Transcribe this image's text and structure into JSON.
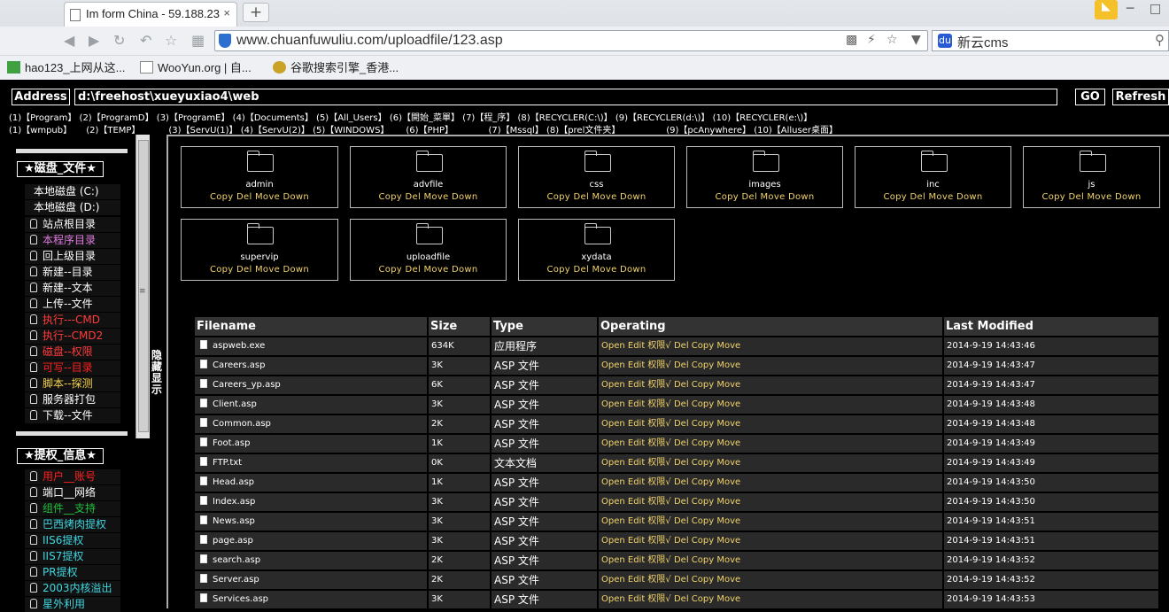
{
  "browser": {
    "tab_title": "Im form China - 59.188.23",
    "tab_close": "×",
    "new_tab": "+",
    "url": "www.chuanfuwuliu.com/uploadfile/123.asp",
    "search_text": "新云cms",
    "search_engine": "du",
    "bookmarks": [
      "hao123_上网从这...",
      "WooYun.org | 自...",
      "谷歌搜索引擎_香港..."
    ]
  },
  "shell": {
    "address_label": "Address",
    "address_value": "d:\\freehost\\xueyuxiao4\\web",
    "go_label": "GO",
    "refresh_label": "Refresh",
    "quick_row1": [
      "(1)【Program】",
      "(2)【ProgramD】",
      "(3)【ProgramE】",
      "(4)【Documents】",
      "(5)【All_Users】",
      "(6)【開始_菜單】",
      "(7)【程_序】",
      "(8)【RECYCLER(C:\\)】",
      "(9)【RECYCLER(d:\\)】",
      "(10)【RECYCLER(e:\\)】"
    ],
    "quick_row2": [
      "(1)【wmpub】",
      "(2)【TEMP】",
      "(3)【ServU(1)】",
      "(4)【ServU(2)】",
      "(5)【WINDOWS】",
      "(6)【PHP】",
      "(7)【Mssql】",
      "(8)【prel文件夹】",
      "(9)【pcAnywhere】",
      "(10)【Alluser桌面】"
    ],
    "hide_show": "隐藏 显示"
  },
  "sidebar": {
    "group1_title": "★磁盘_文件★",
    "disks": [
      "本地磁盘 (C:)",
      "本地磁盘 (D:)"
    ],
    "group1_items": [
      {
        "label": "站点根目录",
        "color": "#ffffff"
      },
      {
        "label": "本程序目录",
        "color": "#e07be0"
      },
      {
        "label": "回上级目录",
        "color": "#ffffff"
      },
      {
        "label": "新建--目录",
        "color": "#ffffff"
      },
      {
        "label": "新建--文本",
        "color": "#ffffff"
      },
      {
        "label": "上传--文件",
        "color": "#ffffff"
      },
      {
        "label": "执行---CMD",
        "color": "#ff3b3b"
      },
      {
        "label": "执行--CMD2",
        "color": "#ff3b3b"
      },
      {
        "label": "磁盘--权限",
        "color": "#ff3b3b"
      },
      {
        "label": "可写--目录",
        "color": "#ff2020"
      },
      {
        "label": "脚本--探测",
        "color": "#f5d34a"
      },
      {
        "label": "服务器打包",
        "color": "#ffffff"
      },
      {
        "label": "下载--文件",
        "color": "#ffffff"
      }
    ],
    "group2_title": "★提权_信息★",
    "group2_items": [
      {
        "label": "用户__账号",
        "color": "#ff2020"
      },
      {
        "label": "端口__网络",
        "color": "#ffffff"
      },
      {
        "label": "组件__支持",
        "color": "#1fbf3a"
      },
      {
        "label": "巴西烤肉提权",
        "color": "#3fd7e0"
      },
      {
        "label": "IIS6提权",
        "color": "#3fd7e0"
      },
      {
        "label": "IIS7提权",
        "color": "#3fd7e0"
      },
      {
        "label": "PR提权",
        "color": "#3fd7e0"
      },
      {
        "label": "2003内核溢出",
        "color": "#3fd7e0"
      },
      {
        "label": "星外利用",
        "color": "#3fd7e0"
      }
    ]
  },
  "folders": {
    "ops": "Copy Del Move Down",
    "names": [
      "admin",
      "advfile",
      "css",
      "images",
      "inc",
      "js",
      "supervip",
      "uploadfile",
      "xydata"
    ]
  },
  "table": {
    "headers": [
      "Filename",
      "Size",
      "Type",
      "Operating",
      "Last Modified"
    ],
    "ops": "Open Edit 权限√ Del Copy Move",
    "rows": [
      [
        "aspweb.exe",
        "634K",
        "应用程序",
        "2014-9-19 14:43:46"
      ],
      [
        "Careers.asp",
        "3K",
        "ASP 文件",
        "2014-9-19 14:43:47"
      ],
      [
        "Careers_yp.asp",
        "6K",
        "ASP 文件",
        "2014-9-19 14:43:47"
      ],
      [
        "Client.asp",
        "3K",
        "ASP 文件",
        "2014-9-19 14:43:48"
      ],
      [
        "Common.asp",
        "2K",
        "ASP 文件",
        "2014-9-19 14:43:48"
      ],
      [
        "Foot.asp",
        "1K",
        "ASP 文件",
        "2014-9-19 14:43:49"
      ],
      [
        "FTP.txt",
        "0K",
        "文本文档",
        "2014-9-19 14:43:49"
      ],
      [
        "Head.asp",
        "1K",
        "ASP 文件",
        "2014-9-19 14:43:50"
      ],
      [
        "Index.asp",
        "3K",
        "ASP 文件",
        "2014-9-19 14:43:50"
      ],
      [
        "News.asp",
        "3K",
        "ASP 文件",
        "2014-9-19 14:43:51"
      ],
      [
        "page.asp",
        "3K",
        "ASP 文件",
        "2014-9-19 14:43:51"
      ],
      [
        "search.asp",
        "2K",
        "ASP 文件",
        "2014-9-19 14:43:52"
      ],
      [
        "Server.asp",
        "2K",
        "ASP 文件",
        "2014-9-19 14:43:52"
      ],
      [
        "Services.asp",
        "3K",
        "ASP 文件",
        "2014-9-19 14:43:53"
      ]
    ]
  }
}
